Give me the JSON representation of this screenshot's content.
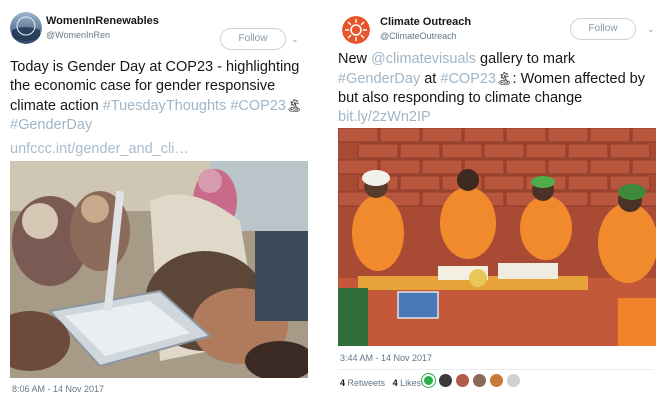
{
  "tweets": [
    {
      "author": "WomenInRenewables",
      "handle": "@WomenInRen",
      "follow_label": "Follow",
      "text_plain1": "Today is Gender Day at COP23 - highlighting the economic case for gender responsive climate action ",
      "tag1": "#TuesdayThoughts",
      "tag2": "#COP23",
      "emoji": "🏝",
      "tag3": "#GenderDay",
      "link": "unfccc.int/gender_and_cli…",
      "timestamp": "8:06 AM - 14 Nov 2017",
      "avatar_icon": "globe-avatar-icon"
    },
    {
      "author": "Climate Outreach",
      "handle": "@ClimateOutreach",
      "follow_label": "Follow",
      "text_new": "New ",
      "mention": "@climatevisuals",
      "text_gallery": " gallery to mark ",
      "tag1": "#GenderDay",
      "text_at": " at ",
      "tag2": "#COP23",
      "emoji": "🏝",
      "text_rest": ": Women affected by but also responding to climate change ",
      "link": "bit.ly/2zWn2IP",
      "timestamp": "3:44 AM - 14 Nov 2017",
      "retweets_count": "4",
      "retweets_label": "Retweets",
      "likes_count": "4",
      "likes_label": "Likes",
      "avatar_icon": "sun-logo-avatar-icon",
      "brand_color": "#e8552a"
    }
  ]
}
